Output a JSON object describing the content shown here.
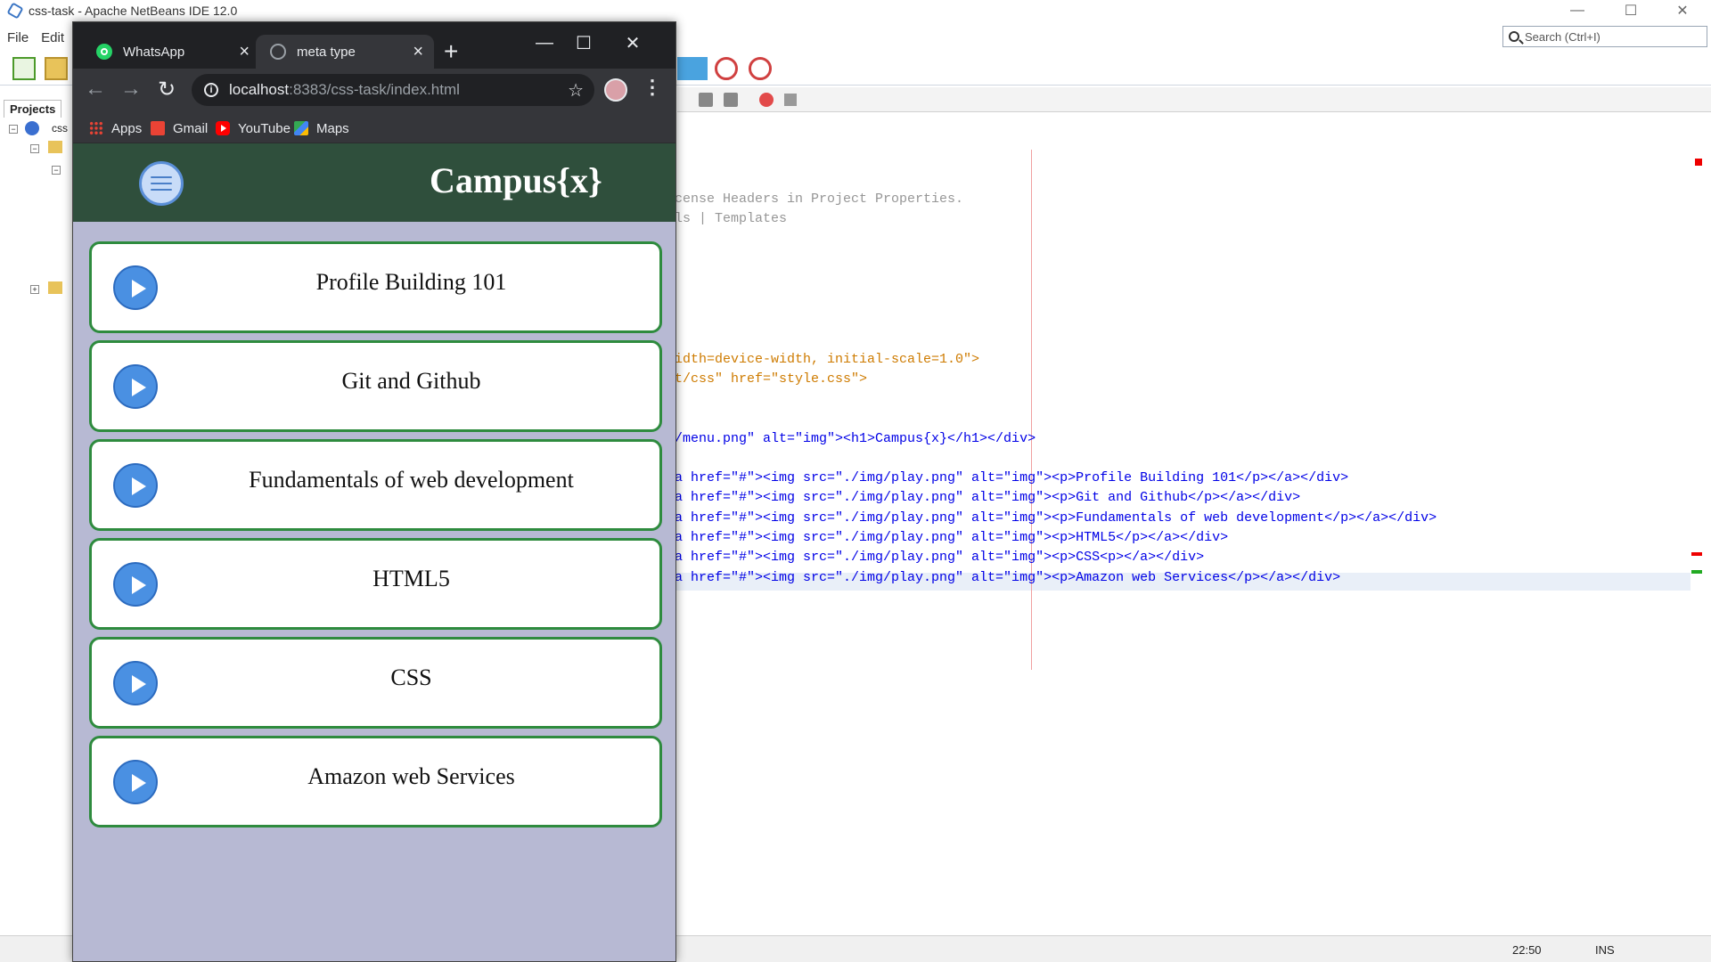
{
  "ide": {
    "title": "css-task - Apache NetBeans IDE 12.0",
    "menu": [
      "File",
      "Edit"
    ],
    "search_placeholder": "Search (Ctrl+I)",
    "projects_tab": "Projects",
    "project_node": "css",
    "status_position": "22:50",
    "status_mode": "INS",
    "code_lines": [
      "cense Headers in Project Properties.",
      "ls | Templates",
      "idth=device-width, initial-scale=1.0\">",
      "t/css\" href=\"style.css\">",
      "/menu.png\" alt=\"img\"><h1>Campus{x}</h1></div>",
      "a href=\"#\"><img src=\"./img/play.png\" alt=\"img\"><p>Profile Building 101</p></a></div>",
      "a href=\"#\"><img src=\"./img/play.png\" alt=\"img\"><p>Git and Github</p></a></div>",
      "a href=\"#\"><img src=\"./img/play.png\" alt=\"img\"><p>Fundamentals of web development</p></a></div>",
      "a href=\"#\"><img src=\"./img/play.png\" alt=\"img\"><p>HTML5</p></a></div>",
      "a href=\"#\"><img src=\"./img/play.png\" alt=\"img\"><p>CSS<p></a></div>",
      "a href=\"#\"><img src=\"./img/play.png\" alt=\"img\"><p>Amazon web Services</p></a></div>"
    ]
  },
  "browser": {
    "tabs": [
      {
        "title": "WhatsApp",
        "icon": "whatsapp-icon",
        "active": false
      },
      {
        "title": "meta type",
        "icon": "globe-icon",
        "active": true
      }
    ],
    "url_host": "localhost",
    "url_path": ":8383/css-task/index.html",
    "bookmarks": [
      {
        "label": "Apps",
        "icon": "apps-grid-icon"
      },
      {
        "label": "Gmail",
        "icon": "gmail-icon"
      },
      {
        "label": "YouTube",
        "icon": "youtube-icon"
      },
      {
        "label": "Maps",
        "icon": "maps-icon"
      }
    ]
  },
  "site": {
    "title": "Campus{x}",
    "courses": [
      "Profile Building 101",
      "Git and Github",
      "Fundamentals of web development",
      "HTML5",
      "CSS",
      "Amazon web Services"
    ],
    "colors": {
      "header_bg": "#2f4f3c",
      "page_bg": "#b7b9d3",
      "card_border": "#2e8b3e",
      "play_button": "#4a90e2"
    }
  }
}
